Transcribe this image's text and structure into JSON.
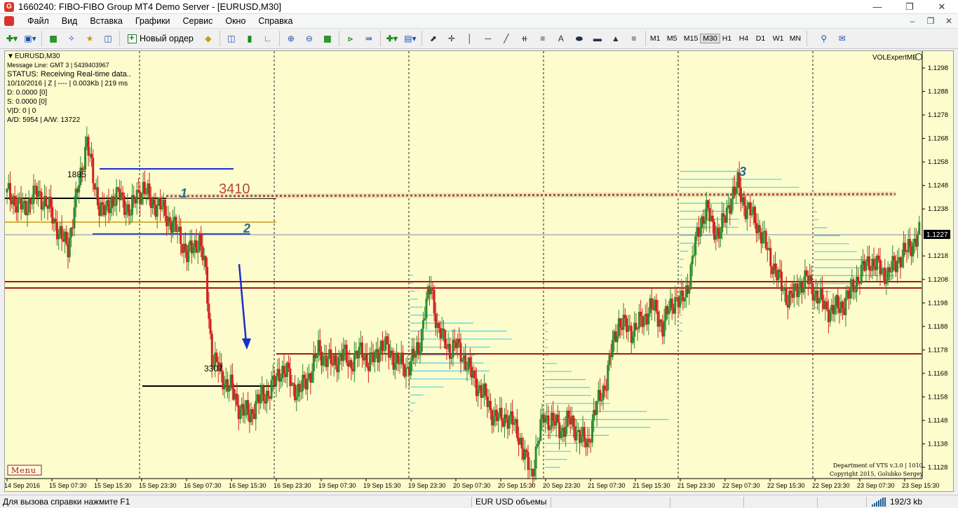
{
  "window": {
    "title": "1660240: FIBO-FIBO Group MT4 Demo Server - [EURUSD,M30]",
    "app_icon_glyph": "G"
  },
  "menu": {
    "items": [
      "Файл",
      "Вид",
      "Вставка",
      "Графики",
      "Сервис",
      "Окно",
      "Справка"
    ]
  },
  "toolbar": {
    "new_order_label": "Новый ордер",
    "text_tool_label": "A",
    "timeframes": [
      "M1",
      "M5",
      "M15",
      "M30",
      "H1",
      "H4",
      "D1",
      "W1",
      "MN"
    ],
    "active_timeframe": "M30"
  },
  "chart": {
    "symbol_header": "EURUSD,M30",
    "info_lines": [
      "Message Line: GMT 3 | 5439403967",
      "STATUS:  Receiving Real-time data..",
      "10/10/2016 | Z | ---- | 0.003Kb | 219 ms",
      "D: 0.0000  [0]",
      "S: 0.0000  [0]",
      "V|D: 0 | 0",
      "A/D: 5954 | A/W: 13722"
    ],
    "indicator_name": "VOLExpertME",
    "menu_label": "Menu",
    "credit_line1": "Department of VTS  v.3.0 | 1010",
    "credit_line2": "Copyright 2015, Golubko Sergey",
    "annotations": {
      "label_1885": "1885",
      "label_3410": "3410",
      "label_3307": "3307",
      "wave_1": "1",
      "wave_2": "2",
      "wave_3": "3"
    },
    "current_price": "1.1227",
    "price_ticks": [
      "1.1298",
      "1.1288",
      "1.1278",
      "1.1268",
      "1.1258",
      "1.1248",
      "1.1238",
      "1.1218",
      "1.1208",
      "1.1198",
      "1.1188",
      "1.1178",
      "1.1168",
      "1.1158",
      "1.1148",
      "1.1138",
      "1.1128"
    ],
    "time_ticks": [
      "14 Sep 2016",
      "15 Sep 07:30",
      "15 Sep 15:30",
      "15 Sep 23:30",
      "16 Sep 07:30",
      "16 Sep 15:30",
      "16 Sep 23:30",
      "19 Sep 07:30",
      "19 Sep 15:30",
      "19 Sep 23:30",
      "20 Sep 07:30",
      "20 Sep 15:30",
      "20 Sep 23:30",
      "21 Sep 07:30",
      "21 Sep 15:30",
      "21 Sep 23:30",
      "22 Sep 07:30",
      "22 Sep 15:30",
      "22 Sep 23:30",
      "23 Sep 07:30",
      "23 Sep 15:30"
    ],
    "colors": {
      "background": "#fdfccc",
      "bull": "#2e8b2e",
      "bear": "#d42020",
      "profile": "#49d4e6",
      "level_red": "#a31818",
      "level_blue": "#1a2fd0"
    },
    "price_path": [
      1.1245,
      1.1243,
      1.124,
      1.1238,
      1.1242,
      1.1245,
      1.1242,
      1.1238,
      1.1232,
      1.1225,
      1.1222,
      1.1238,
      1.1252,
      1.1268,
      1.125,
      1.124,
      1.1236,
      1.1242,
      1.1244,
      1.124,
      1.1237,
      1.1244,
      1.1247,
      1.1242,
      1.124,
      1.1238,
      1.1234,
      1.123,
      1.1226,
      1.1218,
      1.1222,
      1.1225,
      1.121,
      1.1175,
      1.117,
      1.1165,
      1.1162,
      1.1155,
      1.1152,
      1.115,
      1.1155,
      1.1158,
      1.116,
      1.1164,
      1.117,
      1.1168,
      1.1162,
      1.116,
      1.1165,
      1.117,
      1.1178,
      1.1175,
      1.1172,
      1.1174,
      1.1176,
      1.1172,
      1.1175,
      1.1178,
      1.1172,
      1.1175,
      1.118,
      1.1178,
      1.1175,
      1.1172,
      1.117,
      1.1174,
      1.1178,
      1.1195,
      1.1205,
      1.1188,
      1.1182,
      1.1178,
      1.118,
      1.1176,
      1.117,
      1.1165,
      1.116,
      1.1156,
      1.115,
      1.1148,
      1.115,
      1.1147,
      1.1142,
      1.1132,
      1.1125,
      1.1138,
      1.115,
      1.1148,
      1.1146,
      1.1144,
      1.1148,
      1.1145,
      1.114,
      1.1138,
      1.115,
      1.1158,
      1.1165,
      1.118,
      1.119,
      1.1188,
      1.1186,
      1.1188,
      1.1192,
      1.1196,
      1.1194,
      1.1188,
      1.1195,
      1.12,
      1.1198,
      1.1205,
      1.122,
      1.1232,
      1.1238,
      1.123,
      1.1228,
      1.1234,
      1.1244,
      1.1248,
      1.124,
      1.1236,
      1.1232,
      1.1226,
      1.1218,
      1.1212,
      1.1205,
      1.12,
      1.1202,
      1.1206,
      1.1208,
      1.1204,
      1.12,
      1.1196,
      1.1195,
      1.1196,
      1.1198,
      1.1202,
      1.1208,
      1.1212,
      1.1216,
      1.1214,
      1.1212,
      1.121,
      1.1214,
      1.1218,
      1.122,
      1.1224,
      1.1227
    ]
  }
}
